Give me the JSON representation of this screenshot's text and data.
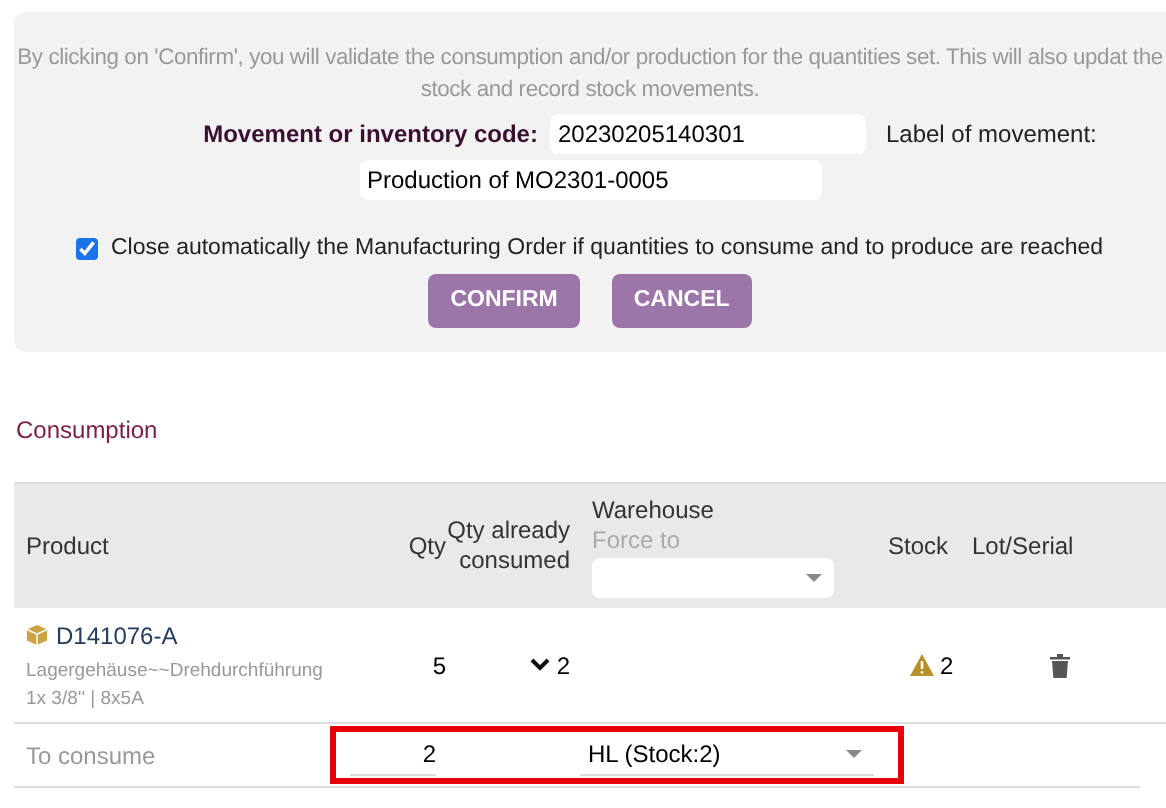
{
  "notice": "By clicking on 'Confirm', you will validate the consumption and/or production for the quantities set. This will also updat the stock and record stock movements.",
  "movement_code": {
    "label": "Movement or inventory code:",
    "value": "20230205140301"
  },
  "movement_label": {
    "label": "Label of movement:",
    "value": "Production of MO2301-0005"
  },
  "auto_close": {
    "label": "Close automatically the Manufacturing Order if quantities to consume and to produce are reached",
    "checked": true
  },
  "buttons": [
    {
      "label": "CONFIRM"
    },
    {
      "label": "CANCEL"
    }
  ],
  "section_title": "Consumption",
  "table": {
    "columns": {
      "product": "Product",
      "qty": "Qty",
      "qty_consumed": "Qty already consumed",
      "warehouse": "Warehouse",
      "force_to": "Force to",
      "stock": "Stock",
      "lot": "Lot/Serial"
    },
    "rows": [
      {
        "ref": "D141076-A",
        "description": "Lagergehäuse~~Drehdurchführung 1x 3/8'' | 8x5A",
        "qty": "5",
        "qty_consumed": "2",
        "stock": "2",
        "stock_warning": true
      }
    ],
    "to_consume": {
      "label": "To consume",
      "qty": "2",
      "warehouse": "HL (Stock:2)",
      "highlighted": true
    }
  }
}
